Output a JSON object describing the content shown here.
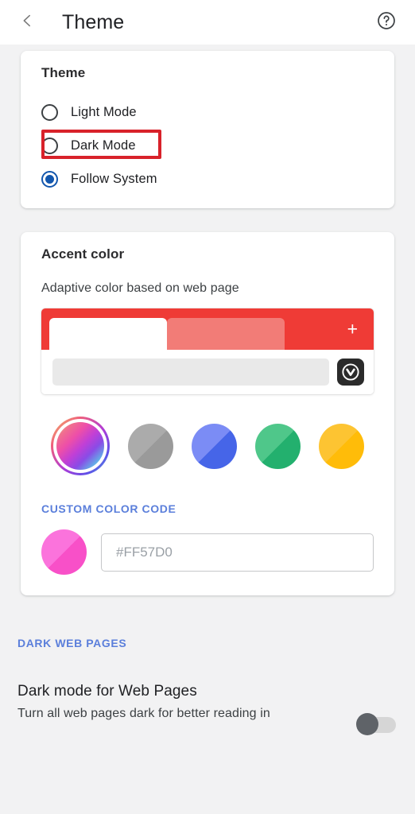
{
  "appbar": {
    "back_icon": "chevron-left-icon",
    "title": "Theme",
    "help_icon": "help-circle-icon"
  },
  "theme_card": {
    "title": "Theme",
    "options": [
      {
        "label": "Light Mode",
        "selected": false
      },
      {
        "label": "Dark Mode",
        "selected": false
      },
      {
        "label": "Follow System",
        "selected": true
      }
    ],
    "highlight_annotation": {
      "target": "Dark Mode",
      "color": "#d8222a"
    }
  },
  "accent_card": {
    "title": "Accent color",
    "subtitle": "Adaptive color based on web page",
    "preview": {
      "tabbar_color": "#ef3b36",
      "active_tab_color": "#ffffff",
      "inactive_tab_color": "#f27c77",
      "new_tab_icon": "plus-icon",
      "new_tab_label": "+",
      "address_bar_color": "#e9e9e9",
      "browser_logo_icon": "vivaldi-logo-icon"
    },
    "swatches": [
      {
        "name": "adaptive",
        "selected": true,
        "color_light": "#e86ad0",
        "color_dark": "#c23bd0"
      },
      {
        "name": "gray",
        "selected": false,
        "color_light": "#ababab",
        "color_dark": "#9a9a9a"
      },
      {
        "name": "blue",
        "selected": false,
        "color_light": "#7b8cf5",
        "color_dark": "#4665e8"
      },
      {
        "name": "green",
        "selected": false,
        "color_light": "#4fc78a",
        "color_dark": "#23b06e"
      },
      {
        "name": "yellow",
        "selected": false,
        "color_light": "#fdc432",
        "color_dark": "#ffbc09"
      }
    ],
    "custom_color": {
      "label": "CUSTOM COLOR CODE",
      "swatch_light": "#fb73dc",
      "swatch_dark": "#f850c8",
      "input_value": "",
      "input_placeholder": "#FF57D0"
    }
  },
  "dark_web_pages": {
    "section_label": "DARK WEB PAGES",
    "items": [
      {
        "title": "Dark mode for Web Pages",
        "description": "Turn all web pages dark for better reading in",
        "toggle_on": false
      }
    ]
  }
}
